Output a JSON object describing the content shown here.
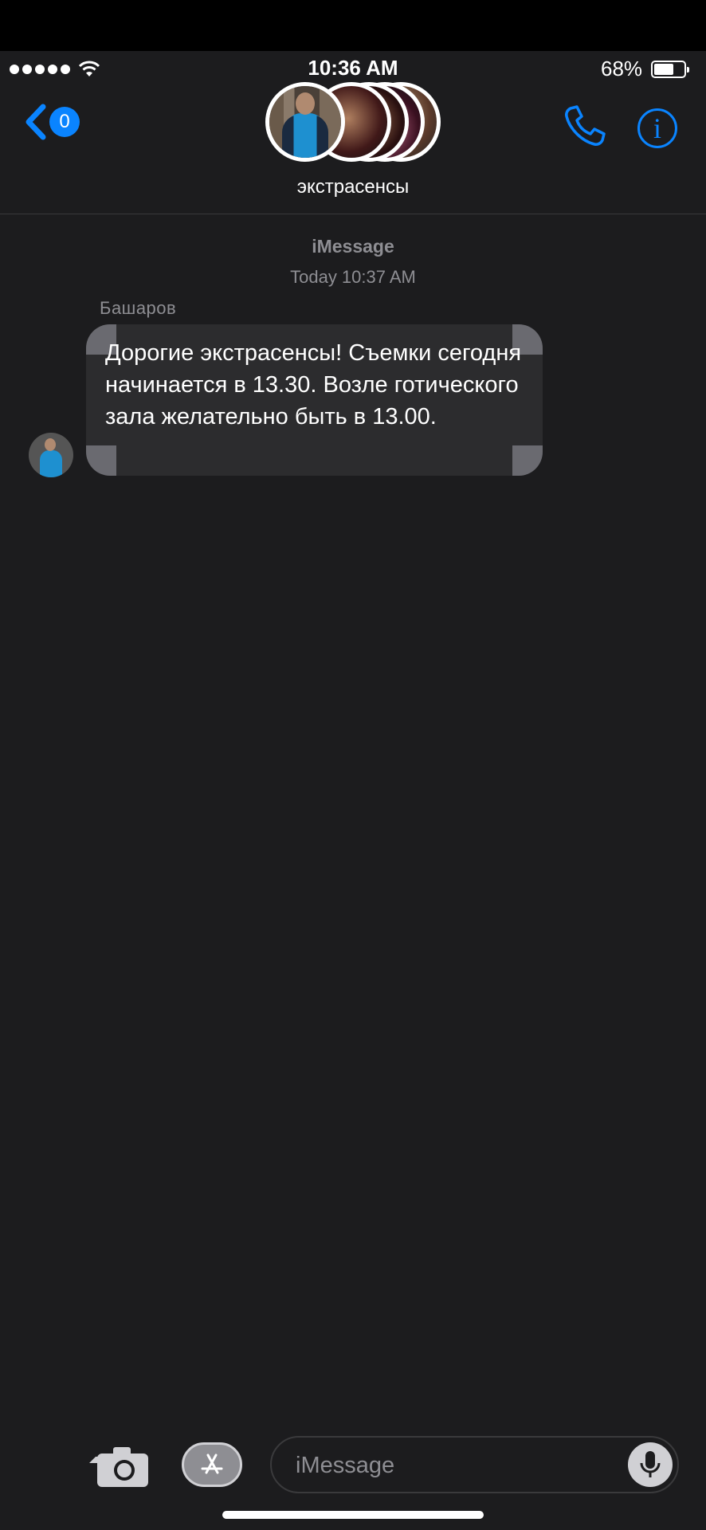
{
  "status_bar": {
    "time": "10:36 AM",
    "battery_percent": "68%",
    "battery_level": 0.66
  },
  "header": {
    "back_badge": "0",
    "group_name": "экстрасенсы",
    "accent_color": "#0a84ff"
  },
  "conversation": {
    "service_label": "iMessage",
    "timestamp": "Today 10:37 AM",
    "messages": [
      {
        "sender": "Башаров",
        "text": "Дорогие экстрасенсы! Съемки сегодня начинается в 13.30. Возле готического зала желательно быть в 13.00."
      }
    ]
  },
  "composer": {
    "placeholder": "iMessage"
  },
  "icons": [
    "back-chevron-icon",
    "wifi-icon",
    "phone-icon",
    "info-icon",
    "camera-icon",
    "app-store-icon",
    "microphone-icon"
  ]
}
